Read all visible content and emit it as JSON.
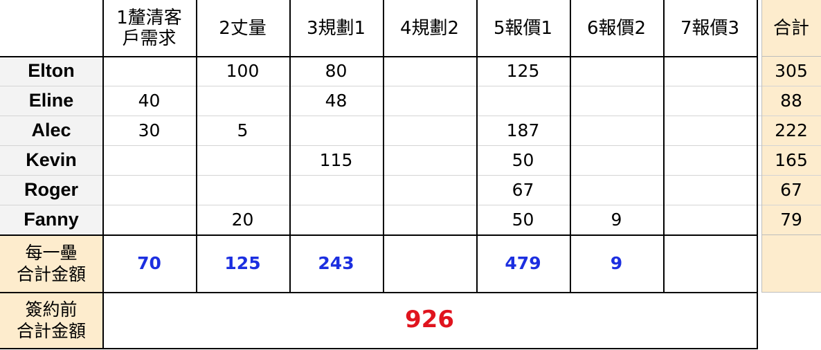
{
  "columns": [
    "1釐清客\n戶需求",
    "2丈量",
    "3規劃1",
    "4規劃2",
    "5報價1",
    "6報價2",
    "7報價3"
  ],
  "total_header": "合計",
  "rows": [
    {
      "name": "Elton",
      "values": [
        "",
        "100",
        "80",
        "",
        "125",
        "",
        ""
      ],
      "total": "305"
    },
    {
      "name": "Eline",
      "values": [
        "40",
        "",
        "48",
        "",
        "",
        "",
        ""
      ],
      "total": "88"
    },
    {
      "name": "Alec",
      "values": [
        "30",
        "5",
        "",
        "",
        "187",
        "",
        ""
      ],
      "total": "222"
    },
    {
      "name": "Kevin",
      "values": [
        "",
        "",
        "115",
        "",
        "50",
        "",
        ""
      ],
      "total": "165"
    },
    {
      "name": "Roger",
      "values": [
        "",
        "",
        "",
        "",
        "67",
        "",
        ""
      ],
      "total": "67"
    },
    {
      "name": "Fanny",
      "values": [
        "",
        "20",
        "",
        "",
        "50",
        "9",
        ""
      ],
      "total": "79"
    }
  ],
  "stage_total": {
    "label": "每一壘\n合計金額",
    "values": [
      "70",
      "125",
      "243",
      "",
      "479",
      "9",
      ""
    ]
  },
  "grand_total": {
    "label": "簽約前\n合計金額",
    "value": "926"
  },
  "colors": {
    "beige": "#fdeccd",
    "gray": "#f3f3f3",
    "blue": "#1c2fe0",
    "red": "#e0141e"
  }
}
